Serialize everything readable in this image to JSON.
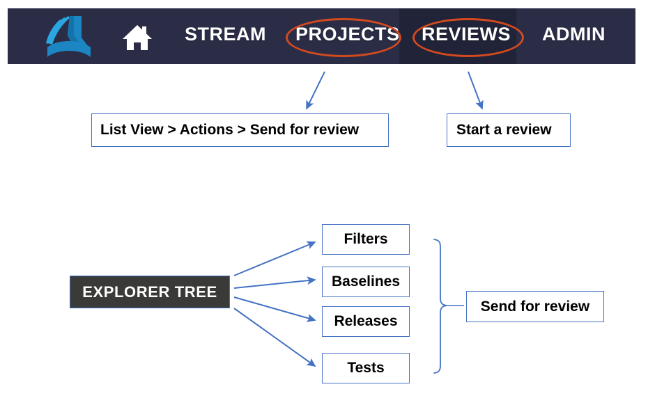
{
  "navbar": {
    "logo_icon": "delta-logo-icon",
    "home_icon": "home-icon",
    "items": [
      {
        "label": "STREAM",
        "highlighted": false,
        "active": false
      },
      {
        "label": "PROJECTS",
        "highlighted": true,
        "active": false
      },
      {
        "label": "REVIEWS",
        "highlighted": true,
        "active": true
      },
      {
        "label": "ADMIN",
        "highlighted": false,
        "active": false
      }
    ],
    "background_color": "#2b2d47",
    "active_background_color": "#212338",
    "highlight_color": "#d44a1f",
    "text_color": "#ffffff"
  },
  "callouts": [
    {
      "label": "List View > Actions > Send for review"
    },
    {
      "label": "Start a review"
    }
  ],
  "diagram": {
    "source": {
      "label": "EXPLORER TREE",
      "background_color": "#3a3a38",
      "text_color": "#ffffff"
    },
    "items": [
      {
        "label": "Filters"
      },
      {
        "label": "Baselines"
      },
      {
        "label": "Releases"
      },
      {
        "label": "Tests"
      }
    ],
    "result": {
      "label": "Send for review"
    },
    "arrow_color": "#4472c4",
    "brace_color": "#4472c4",
    "box_border_color": "#4472c4"
  }
}
